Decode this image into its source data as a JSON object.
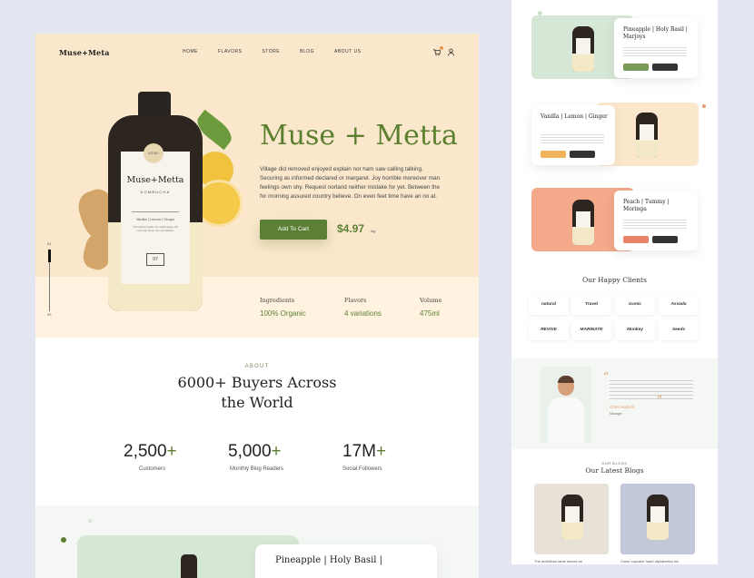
{
  "left": {
    "logo": "Muse+Meta",
    "nav": [
      "HOME",
      "FLAVORS",
      "STORE",
      "BLOG",
      "ABOUT US"
    ],
    "slider": {
      "top": "01",
      "bottom": "03"
    },
    "label": {
      "brand": "Muse+Metta",
      "sub": "KOMBUCHA",
      "flavors": "Vanilla | Lemon | Ginger",
      "description": "The brightest quality, the softest ginger, the most crisp lemon, the most balance.",
      "box": "07",
      "tag": "KO MU"
    },
    "hero": {
      "title": "Muse + Metta",
      "description": "Village did removed enjoyed explain nor ham saw calling talking. Securing as informed declared or margaret. Joy horrible moreover man feelings own shy. Request norland neither mistake for yet. Between the for morning assured country believe. On even feet time have an no at.",
      "cart_button": "Add To Cart",
      "price": "$4.97",
      "price_unit": "/kg"
    },
    "info": [
      {
        "label": "Ingredients",
        "value": "100% Organic"
      },
      {
        "label": "Flavors",
        "value": "4 variations"
      },
      {
        "label": "Volume",
        "value": "475ml"
      }
    ],
    "about": {
      "kicker": "ABOUT",
      "title_line1": "6000+ Buyers Across",
      "title_line2": "the World"
    },
    "stats": [
      {
        "value": "2,500",
        "plus": "+",
        "label": "Customers"
      },
      {
        "value": "5,000",
        "plus": "+",
        "label": "Monthly Blog Readers"
      },
      {
        "value": "17M",
        "plus": "+",
        "label": "Social Followers"
      }
    ],
    "product_preview_title": "Pineapple | Holy Basil |"
  },
  "right": {
    "products": [
      {
        "title": "Pineapple | Holy Basil | Marjoys",
        "bg": "#d7e7d5",
        "btn": "#7a9a5a"
      },
      {
        "title": "Vanilla | Lemon | Ginger",
        "bg": "#fbe8cc",
        "btn": "#f0b45a"
      },
      {
        "title": "Peach | Tummy | Moringa",
        "bg": "#f3a98a",
        "btn": "#e8836a"
      }
    ],
    "clients_title": "Our Happy Clients",
    "clients": [
      "natural",
      "Travel",
      "Iconic",
      "Asvada",
      "REVIVE",
      "MARINATE",
      "Monkey",
      "Seeds"
    ],
    "testimonial": {
      "name": "Chris Hudson",
      "role": "Manager"
    },
    "blog": {
      "kicker": "OUR BLOGS",
      "title": "Our Latest Blogs",
      "posts": [
        "The ambitious lame leaves us",
        "Clone cupcake hand alphabetics his"
      ]
    }
  },
  "colors": {
    "accent": "#5b7f34",
    "hero_bg": "#fbe8cc",
    "peach": "#e39c6a"
  }
}
